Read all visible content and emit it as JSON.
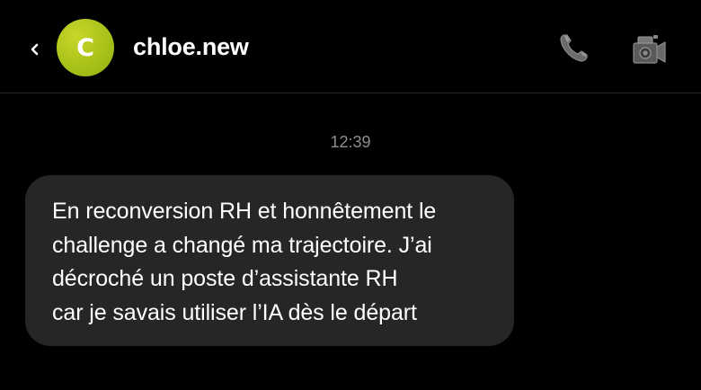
{
  "header": {
    "back_icon": "chevron-left-icon",
    "avatar_letter": "C",
    "avatar_color": "#a9c21a",
    "username": "chloe.new",
    "call_icon": "phone-icon",
    "video_icon": "video-camera-icon"
  },
  "conversation": {
    "timestamp": "12:39",
    "messages": [
      {
        "text": "En reconversion RH et honnêtement le\nchallenge a changé ma trajectoire. J’ai\ndécroché un poste d’assistante RH\ncar je savais utiliser l’IA dès le départ",
        "bubble_color": "#262626"
      }
    ]
  },
  "colors": {
    "background": "#000000",
    "timestamp": "#8e8e8e",
    "text": "#ffffff"
  }
}
